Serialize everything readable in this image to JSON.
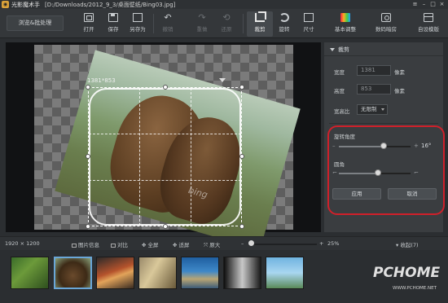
{
  "titlebar": {
    "app_name": "光影魔术手",
    "file_path": "[D:/Downloads/2012_9_3/桌面壁纸/Bing03.jpg]",
    "window_buttons": [
      "≡",
      "–",
      "□",
      "×"
    ]
  },
  "toolbar": {
    "batch_button": "浏览&批处理",
    "buttons": {
      "open": "打开",
      "save": "保存",
      "save_as": "另存为",
      "undo": "撤销",
      "redo": "重做",
      "restore": "还原",
      "crop": "裁剪",
      "rotate": "旋转",
      "size": "尺寸",
      "basic_adjust": "基本调整",
      "digital_darkroom": "数码暗房",
      "custom_template": "自设模版"
    }
  },
  "canvas": {
    "crop_size_label": "1381*853",
    "watermark": "bing",
    "rotation_deg": 16
  },
  "panel": {
    "title": "裁剪",
    "width_label": "宽度",
    "width_value": "1381",
    "height_label": "高度",
    "height_value": "853",
    "unit": "像素",
    "ratio_label": "宽高比",
    "ratio_value": "无限制",
    "rotate_angle_label": "旋转角度",
    "rotate_angle_value": "16°",
    "rotate_angle_fraction": 0.62,
    "corner_label": "圆角",
    "corner_fraction": 0.55,
    "apply_button": "应用",
    "cancel_button": "取消"
  },
  "statusbar": {
    "image_size": "1920 × 1200",
    "image_info": "图片信息",
    "compare": "对比",
    "fullscreen": "全屏",
    "fit": "适屏",
    "original": "原大",
    "zoom": "25%",
    "zoom_fraction": 0.0,
    "collapse": "收起(7)"
  },
  "watermark_site": {
    "logo": "PCHOME",
    "url": "WWW.PCHOME.NET"
  },
  "colors": {
    "highlight": "#d0202a",
    "selected_thumb": "#6aa7d8"
  },
  "filmstrip": {
    "count": 7,
    "selected_index": 1
  }
}
